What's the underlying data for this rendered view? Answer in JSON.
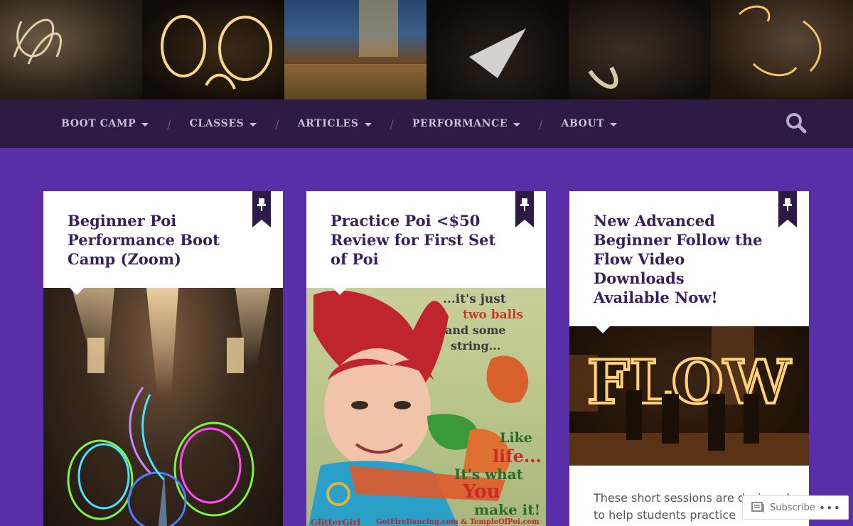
{
  "nav": {
    "items": [
      {
        "label": "BOOT CAMP"
      },
      {
        "label": "CLASSES"
      },
      {
        "label": "ARTICLES"
      },
      {
        "label": "PERFORMANCE"
      },
      {
        "label": "ABOUT"
      }
    ],
    "separator": "/",
    "search_icon": "search-icon"
  },
  "cards": [
    {
      "title": "Beginner Poi Performance Boot Camp (Zoom)",
      "pinned": true
    },
    {
      "title": "Practice Poi <$50 Review for First Set of Poi",
      "pinned": true,
      "image_text": {
        "line1": "...it's just",
        "line2": "two balls",
        "line3": "and some",
        "line4": "string...",
        "like": "Like",
        "life": "life...",
        "its_what": "It's what",
        "you": "You",
        "make_it": "make it!",
        "brand": "GlitterGirl",
        "sites": "GotFireDancing.com & TempleOfPoi.com"
      }
    },
    {
      "title": "New Advanced Beginner Follow the Flow Video Downloads Available Now!",
      "pinned": true,
      "image_text": "FLOW",
      "excerpt": "These short sessions are designed to help students practice"
    }
  ],
  "subscribe": {
    "label": "Subscribe",
    "more": "•••"
  },
  "colors": {
    "background": "#5a2ea6",
    "nav": "#2d1a45",
    "title": "#3a1f5c",
    "pin": "#2d1a45"
  }
}
